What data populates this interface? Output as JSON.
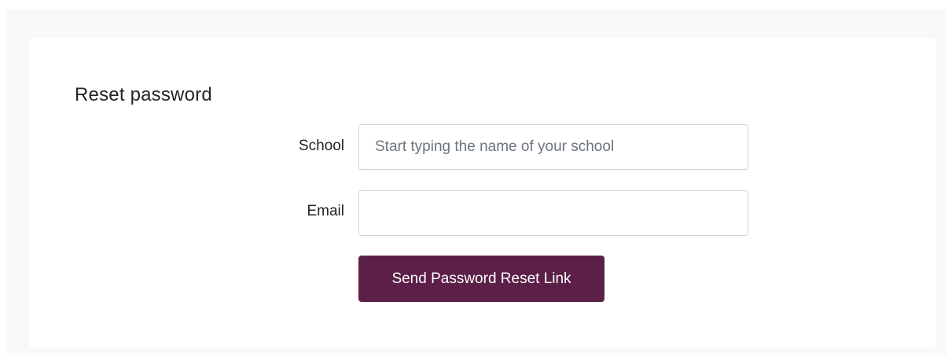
{
  "form": {
    "title": "Reset password",
    "school_label": "School",
    "school_placeholder": "Start typing the name of your school",
    "school_value": "",
    "email_label": "Email",
    "email_placeholder": "",
    "email_value": "",
    "submit_label": "Send Password Reset Link"
  },
  "colors": {
    "accent": "#5c1f48",
    "page_background": "#f8f9fb",
    "card_background": "#ffffff"
  }
}
